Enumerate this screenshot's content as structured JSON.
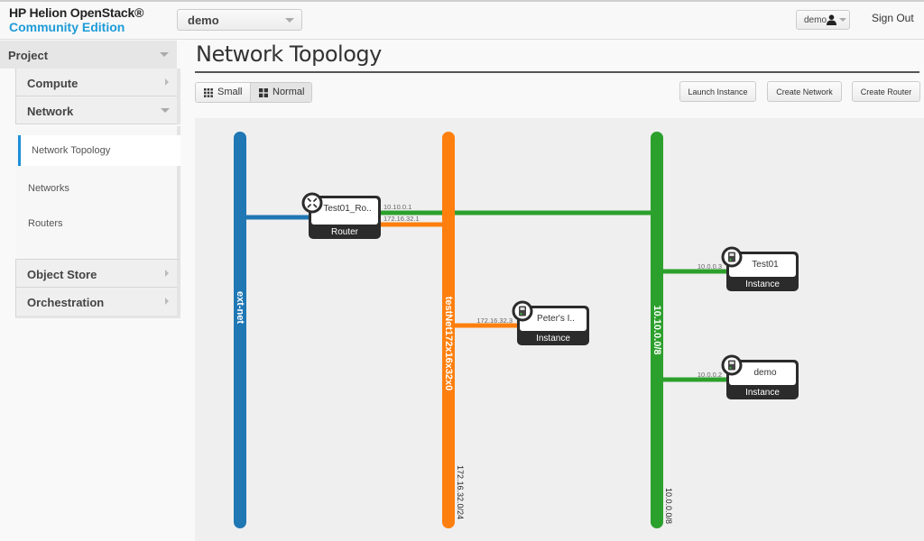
{
  "header": {
    "brand_line1": "HP Helion OpenStack®",
    "brand_line2": "Community Edition",
    "project_select": "demo",
    "user_menu": "demo",
    "sign_out": "Sign Out"
  },
  "sidebar": {
    "dashboard": "Project",
    "categories": [
      {
        "label": "Compute",
        "expanded": false
      },
      {
        "label": "Network",
        "expanded": true
      },
      {
        "label": "Object Store",
        "expanded": false
      },
      {
        "label": "Orchestration",
        "expanded": false
      }
    ],
    "network_items": [
      {
        "label": "Network Topology",
        "active": true
      },
      {
        "label": "Networks",
        "active": false
      },
      {
        "label": "Routers",
        "active": false
      }
    ]
  },
  "main": {
    "title": "Network Topology",
    "view_toggle": [
      {
        "label": "Small",
        "icon": "grid-small-icon",
        "active": false
      },
      {
        "label": "Normal",
        "icon": "grid-large-icon",
        "active": true
      }
    ],
    "actions": {
      "launch_instance": "Launch Instance",
      "create_network": "Create Network",
      "create_router": "Create Router"
    }
  },
  "topology": {
    "networks": [
      {
        "name": "ext-net",
        "cidr": "",
        "color": "#1f77b4"
      },
      {
        "name": "testNet172x16x32x0",
        "cidr": "172.16.32.0/24",
        "color": "#ff7f0e"
      },
      {
        "name": "10.10.0.0/8",
        "cidr": "10.0.0.0/8",
        "color": "#2ca02c"
      }
    ],
    "router": {
      "name": "Test01_Ro..",
      "type": "Router",
      "ports": [
        {
          "ip": "10.10.0.1",
          "network": 2
        },
        {
          "ip": "172.16.32.1",
          "network": 1
        }
      ]
    },
    "instances": [
      {
        "name": "Peter's I..",
        "type": "Instance",
        "ip": "172.16.32.3",
        "network": 1
      },
      {
        "name": "Test01",
        "type": "Instance",
        "ip": "10.0.0.3",
        "network": 2
      },
      {
        "name": "demo",
        "type": "Instance",
        "ip": "10.0.0.2",
        "network": 2
      }
    ]
  }
}
